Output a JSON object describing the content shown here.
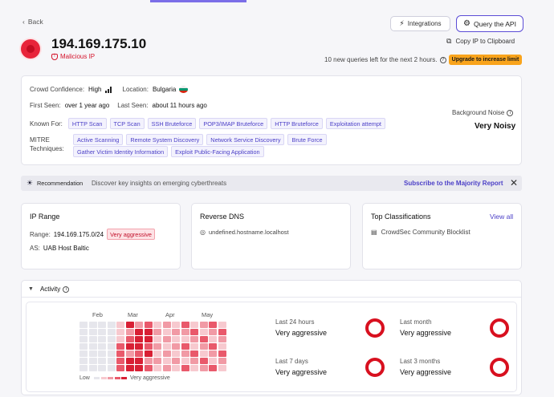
{
  "nav": {
    "back_label": "Back"
  },
  "header": {
    "ip": "194.169.175.10",
    "verdict": "Malicious IP",
    "integrations_label": "Integrations",
    "query_api_label": "Query the API",
    "copy_ip_label": "Copy IP to Clipboard",
    "queries_left": "10 new queries left for the next 2 hours.",
    "upgrade_label": "Upgrade to increase limit"
  },
  "summary": {
    "confidence_label": "Crowd Confidence:",
    "confidence_value": "High",
    "location_label": "Location:",
    "location_value": "Bulgaria",
    "first_seen_label": "First Seen:",
    "first_seen_value": "over 1 year ago",
    "last_seen_label": "Last Seen:",
    "last_seen_value": "about 11 hours ago",
    "known_for_label": "Known For:",
    "known_for": [
      "HTTP Scan",
      "TCP Scan",
      "SSH Bruteforce",
      "POP3/IMAP Bruteforce",
      "HTTP Bruteforce",
      "Exploitation attempt"
    ],
    "mitre_label_1": "MITRE",
    "mitre_label_2": "Techniques:",
    "mitre_row1": [
      "Active Scanning",
      "Remote System Discovery",
      "Network Service Discovery",
      "Brute Force"
    ],
    "mitre_row2": [
      "Gather Victim Identity Information",
      "Exploit Public-Facing Application"
    ],
    "noise_label": "Background Noise",
    "noise_value": "Very Noisy"
  },
  "recommendation": {
    "label": "Recommendation",
    "text": "Discover key insights on emerging cyberthreats",
    "link": "Subscribe to the Majority Report"
  },
  "ip_range": {
    "title": "IP Range",
    "range_label": "Range:",
    "range_value": "194.169.175.0/24",
    "range_badge": "Very aggressive",
    "as_label": "AS:",
    "as_value": "UAB Host Baltic"
  },
  "reverse_dns": {
    "title": "Reverse DNS",
    "value": "undefined.hostname.localhost"
  },
  "classifications": {
    "title": "Top Classifications",
    "view_all": "View all",
    "item": "CrowdSec Community Blocklist"
  },
  "activity": {
    "title": "Activity",
    "months": [
      "Feb",
      "Mar",
      "Apr",
      "May"
    ],
    "legend_low": "Low",
    "legend_high": "Very aggressive",
    "stats": [
      {
        "label": "Last 24 hours",
        "value": "Very aggressive"
      },
      {
        "label": "Last month",
        "value": "Very aggressive"
      },
      {
        "label": "Last 7 days",
        "value": "Very aggressive"
      },
      {
        "label": "Last 3 months",
        "value": "Very aggressive"
      }
    ],
    "heat_colors": [
      "#e6e6ec",
      "#f7c9cf",
      "#f19aa5",
      "#e9596b",
      "#d81f34"
    ]
  }
}
